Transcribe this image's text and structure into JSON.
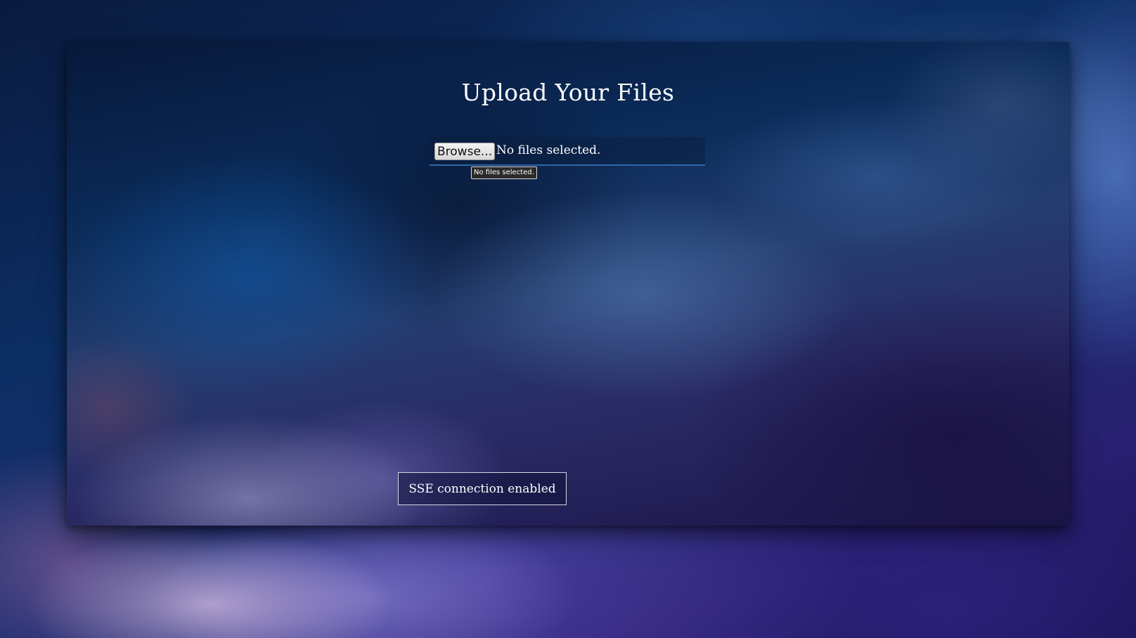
{
  "page": {
    "title": "Upload Your Files"
  },
  "upload": {
    "browse_label": "Browse...",
    "status_text": "No files selected.",
    "tooltip_text": "No files selected."
  },
  "connection": {
    "status_text": "SSE connection enabled"
  }
}
